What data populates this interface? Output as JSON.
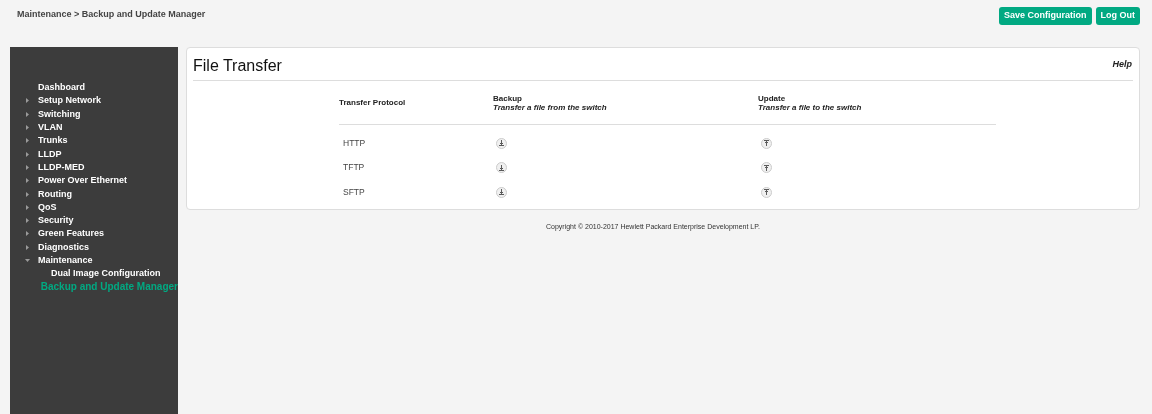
{
  "breadcrumb": "Maintenance > Backup and Update Manager",
  "header_buttons": [
    "Save Configuration",
    "Log Out"
  ],
  "sidebar": {
    "items": [
      {
        "label": "Dashboard",
        "kind": "link",
        "selected": false
      },
      {
        "label": "Setup Network",
        "kind": "group",
        "expanded": false,
        "selected": false
      },
      {
        "label": "Switching",
        "kind": "group",
        "expanded": false,
        "selected": false
      },
      {
        "label": "VLAN",
        "kind": "group",
        "expanded": false,
        "selected": false
      },
      {
        "label": "Trunks",
        "kind": "group",
        "expanded": false,
        "selected": false
      },
      {
        "label": "LLDP",
        "kind": "group",
        "expanded": false,
        "selected": false
      },
      {
        "label": "LLDP-MED",
        "kind": "group",
        "expanded": false,
        "selected": false
      },
      {
        "label": "Power Over Ethernet",
        "kind": "group",
        "expanded": false,
        "selected": false
      },
      {
        "label": "Routing",
        "kind": "group",
        "expanded": false,
        "selected": false
      },
      {
        "label": "QoS",
        "kind": "group",
        "expanded": false,
        "selected": false
      },
      {
        "label": "Security",
        "kind": "group",
        "expanded": false,
        "selected": false
      },
      {
        "label": "Green Features",
        "kind": "group",
        "expanded": false,
        "selected": false
      },
      {
        "label": "Diagnostics",
        "kind": "group",
        "expanded": false,
        "selected": false
      },
      {
        "label": "Maintenance",
        "kind": "group",
        "expanded": true,
        "selected": false,
        "children": [
          {
            "label": "Dual Image Configuration",
            "selected": false
          },
          {
            "label": "Backup and Update Manager",
            "selected": true
          }
        ]
      }
    ]
  },
  "panel": {
    "title": "File Transfer",
    "help": "Help",
    "table": {
      "columns": [
        {
          "title": "Transfer Protocol"
        },
        {
          "title": "Backup",
          "subtitle": "Transfer a file from the switch"
        },
        {
          "title": "Update",
          "subtitle": "Transfer a file to the switch"
        }
      ],
      "rows": [
        {
          "protocol": "HTTP"
        },
        {
          "protocol": "TFTP"
        },
        {
          "protocol": "SFTP"
        }
      ]
    }
  },
  "footer": "Copyright © 2010-2017 Hewlett Packard Enterprise Development LP."
}
